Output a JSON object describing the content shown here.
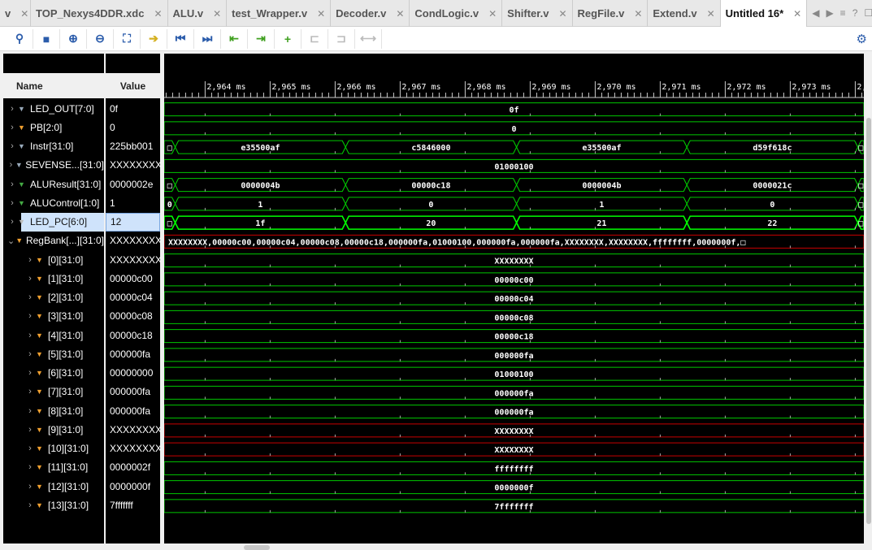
{
  "tabs": [
    {
      "label": "v"
    },
    {
      "label": "TOP_Nexys4DDR.xdc"
    },
    {
      "label": "ALU.v"
    },
    {
      "label": "test_Wrapper.v"
    },
    {
      "label": "Decoder.v"
    },
    {
      "label": "CondLogic.v"
    },
    {
      "label": "Shifter.v"
    },
    {
      "label": "RegFile.v"
    },
    {
      "label": "Extend.v"
    },
    {
      "label": "Untitled 16*",
      "active": true
    }
  ],
  "toolbar": [
    "search-icon",
    "save-icon",
    "zoom-in-icon",
    "zoom-out-icon",
    "zoom-fit-icon",
    "go-to-cursor-icon",
    "go-to-start-icon",
    "go-to-end-icon",
    "previous-transition-icon",
    "next-transition-icon",
    "add-marker-icon",
    "previous-marker-icon",
    "next-marker-icon",
    "swap-cursors-icon"
  ],
  "columns": {
    "name": "Name",
    "value": "Value"
  },
  "time_axis": {
    "unit": "ms",
    "labels": [
      "2,964 ms",
      "2,965 ms",
      "2,966 ms",
      "2,967 ms",
      "2,968 ms",
      "2,969 ms",
      "2,970 ms",
      "2,971 ms",
      "2,972 ms",
      "2,973 ms",
      "2,"
    ],
    "ticks_ms": [
      2964,
      2965,
      2966,
      2967,
      2968,
      2969,
      2970,
      2971,
      2972,
      2973,
      2974
    ]
  },
  "colors": {
    "wave": "#00c800",
    "wave_bright": "#00ff00",
    "undefined": "#c80000",
    "selected": "#cfe3fb"
  },
  "signals": [
    {
      "name": "LED_OUT[7:0]",
      "value": "0f",
      "expand": ">",
      "icon": "#9ab",
      "segments": [
        {
          "t": 2963,
          "v": "0f"
        }
      ]
    },
    {
      "name": "PB[2:0]",
      "value": "0",
      "expand": ">",
      "icon": "#f0a030",
      "segments": [
        {
          "t": 2963,
          "v": "0"
        }
      ]
    },
    {
      "name": "Instr[31:0]",
      "value": "225bb001",
      "expand": ">",
      "icon": "#9ab",
      "segments": [
        {
          "t": 2963,
          "v": "□"
        },
        {
          "t": 2963.54,
          "v": "e35500af"
        },
        {
          "t": 2966.16,
          "v": "c5846000"
        },
        {
          "t": 2968.79,
          "v": "e35500af"
        },
        {
          "t": 2971.41,
          "v": "d59f618c"
        },
        {
          "t": 2974.04,
          "v": "□"
        }
      ]
    },
    {
      "name": "SEVENSE...[31:0]",
      "value": "XXXXXXXX",
      "expand": ">",
      "icon": "#9ab",
      "segments": [
        {
          "t": 2963,
          "v": "01000100"
        }
      ]
    },
    {
      "name": "ALUResult[31:0]",
      "value": "0000002e",
      "expand": ">",
      "icon": "#4a4",
      "segments": [
        {
          "t": 2963,
          "v": "□"
        },
        {
          "t": 2963.54,
          "v": "0000004b"
        },
        {
          "t": 2966.16,
          "v": "00000c18"
        },
        {
          "t": 2968.79,
          "v": "0000004b"
        },
        {
          "t": 2971.41,
          "v": "0000021c"
        },
        {
          "t": 2974.04,
          "v": "□"
        }
      ]
    },
    {
      "name": "ALUControl[1:0]",
      "value": "1",
      "expand": ">",
      "icon": "#4a4",
      "segments": [
        {
          "t": 2963,
          "v": "0"
        },
        {
          "t": 2963.54,
          "v": "1"
        },
        {
          "t": 2966.16,
          "v": "0"
        },
        {
          "t": 2968.79,
          "v": "1"
        },
        {
          "t": 2971.41,
          "v": "0"
        },
        {
          "t": 2974.04,
          "v": "□"
        }
      ]
    },
    {
      "name": "LED_PC[6:0]",
      "value": "12",
      "expand": ">",
      "icon": "#bbb",
      "selected": true,
      "bright": true,
      "segments": [
        {
          "t": 2963,
          "v": "□"
        },
        {
          "t": 2963.54,
          "v": "1f"
        },
        {
          "t": 2966.16,
          "v": "20"
        },
        {
          "t": 2968.79,
          "v": "21"
        },
        {
          "t": 2971.41,
          "v": "22"
        },
        {
          "t": 2974.04,
          "v": "□"
        }
      ]
    },
    {
      "name": "RegBank[...][31:0]",
      "value": "XXXXXXXX,",
      "expand": "v",
      "icon": "#f0a030",
      "red": true,
      "left": true,
      "segments": [
        {
          "t": 2963,
          "v": "XXXXXXXX,00000c00,00000c04,00000c08,00000c18,000000fa,01000100,000000fa,000000fa,XXXXXXXX,XXXXXXXX,ffffffff,0000000f,□"
        }
      ]
    },
    {
      "name": "[0][31:0]",
      "value": "XXXXXXXX",
      "expand": ">",
      "icon": "#f0a030",
      "child": true,
      "segments": [
        {
          "t": 2963,
          "v": "XXXXXXXX"
        }
      ]
    },
    {
      "name": "[1][31:0]",
      "value": "00000c00",
      "expand": ">",
      "icon": "#f0a030",
      "child": true,
      "segments": [
        {
          "t": 2963,
          "v": "00000c00"
        }
      ]
    },
    {
      "name": "[2][31:0]",
      "value": "00000c04",
      "expand": ">",
      "icon": "#f0a030",
      "child": true,
      "segments": [
        {
          "t": 2963,
          "v": "00000c04"
        }
      ]
    },
    {
      "name": "[3][31:0]",
      "value": "00000c08",
      "expand": ">",
      "icon": "#f0a030",
      "child": true,
      "segments": [
        {
          "t": 2963,
          "v": "00000c08"
        }
      ]
    },
    {
      "name": "[4][31:0]",
      "value": "00000c18",
      "expand": ">",
      "icon": "#f0a030",
      "child": true,
      "segments": [
        {
          "t": 2963,
          "v": "00000c18"
        }
      ]
    },
    {
      "name": "[5][31:0]",
      "value": "000000fa",
      "expand": ">",
      "icon": "#f0a030",
      "child": true,
      "segments": [
        {
          "t": 2963,
          "v": "000000fa"
        }
      ]
    },
    {
      "name": "[6][31:0]",
      "value": "00000000",
      "expand": ">",
      "icon": "#f0a030",
      "child": true,
      "segments": [
        {
          "t": 2963,
          "v": "01000100"
        }
      ]
    },
    {
      "name": "[7][31:0]",
      "value": "000000fa",
      "expand": ">",
      "icon": "#f0a030",
      "child": true,
      "segments": [
        {
          "t": 2963,
          "v": "000000fa"
        }
      ]
    },
    {
      "name": "[8][31:0]",
      "value": "000000fa",
      "expand": ">",
      "icon": "#f0a030",
      "child": true,
      "segments": [
        {
          "t": 2963,
          "v": "000000fa"
        }
      ]
    },
    {
      "name": "[9][31:0]",
      "value": "XXXXXXXX",
      "expand": ">",
      "icon": "#f0a030",
      "child": true,
      "red": true,
      "segments": [
        {
          "t": 2963,
          "v": "XXXXXXXX"
        }
      ]
    },
    {
      "name": "[10][31:0]",
      "value": "XXXXXXXX",
      "expand": ">",
      "icon": "#f0a030",
      "child": true,
      "red": true,
      "segments": [
        {
          "t": 2963,
          "v": "XXXXXXXX"
        }
      ]
    },
    {
      "name": "[11][31:0]",
      "value": "0000002f",
      "expand": ">",
      "icon": "#f0a030",
      "child": true,
      "segments": [
        {
          "t": 2963,
          "v": "ffffffff"
        }
      ]
    },
    {
      "name": "[12][31:0]",
      "value": "0000000f",
      "expand": ">",
      "icon": "#f0a030",
      "child": true,
      "segments": [
        {
          "t": 2963,
          "v": "0000000f"
        }
      ]
    },
    {
      "name": "[13][31:0]",
      "value": "7fffffff",
      "expand": ">",
      "icon": "#f0a030",
      "child": true,
      "segments": [
        {
          "t": 2963,
          "v": "7fffffff"
        }
      ]
    }
  ]
}
